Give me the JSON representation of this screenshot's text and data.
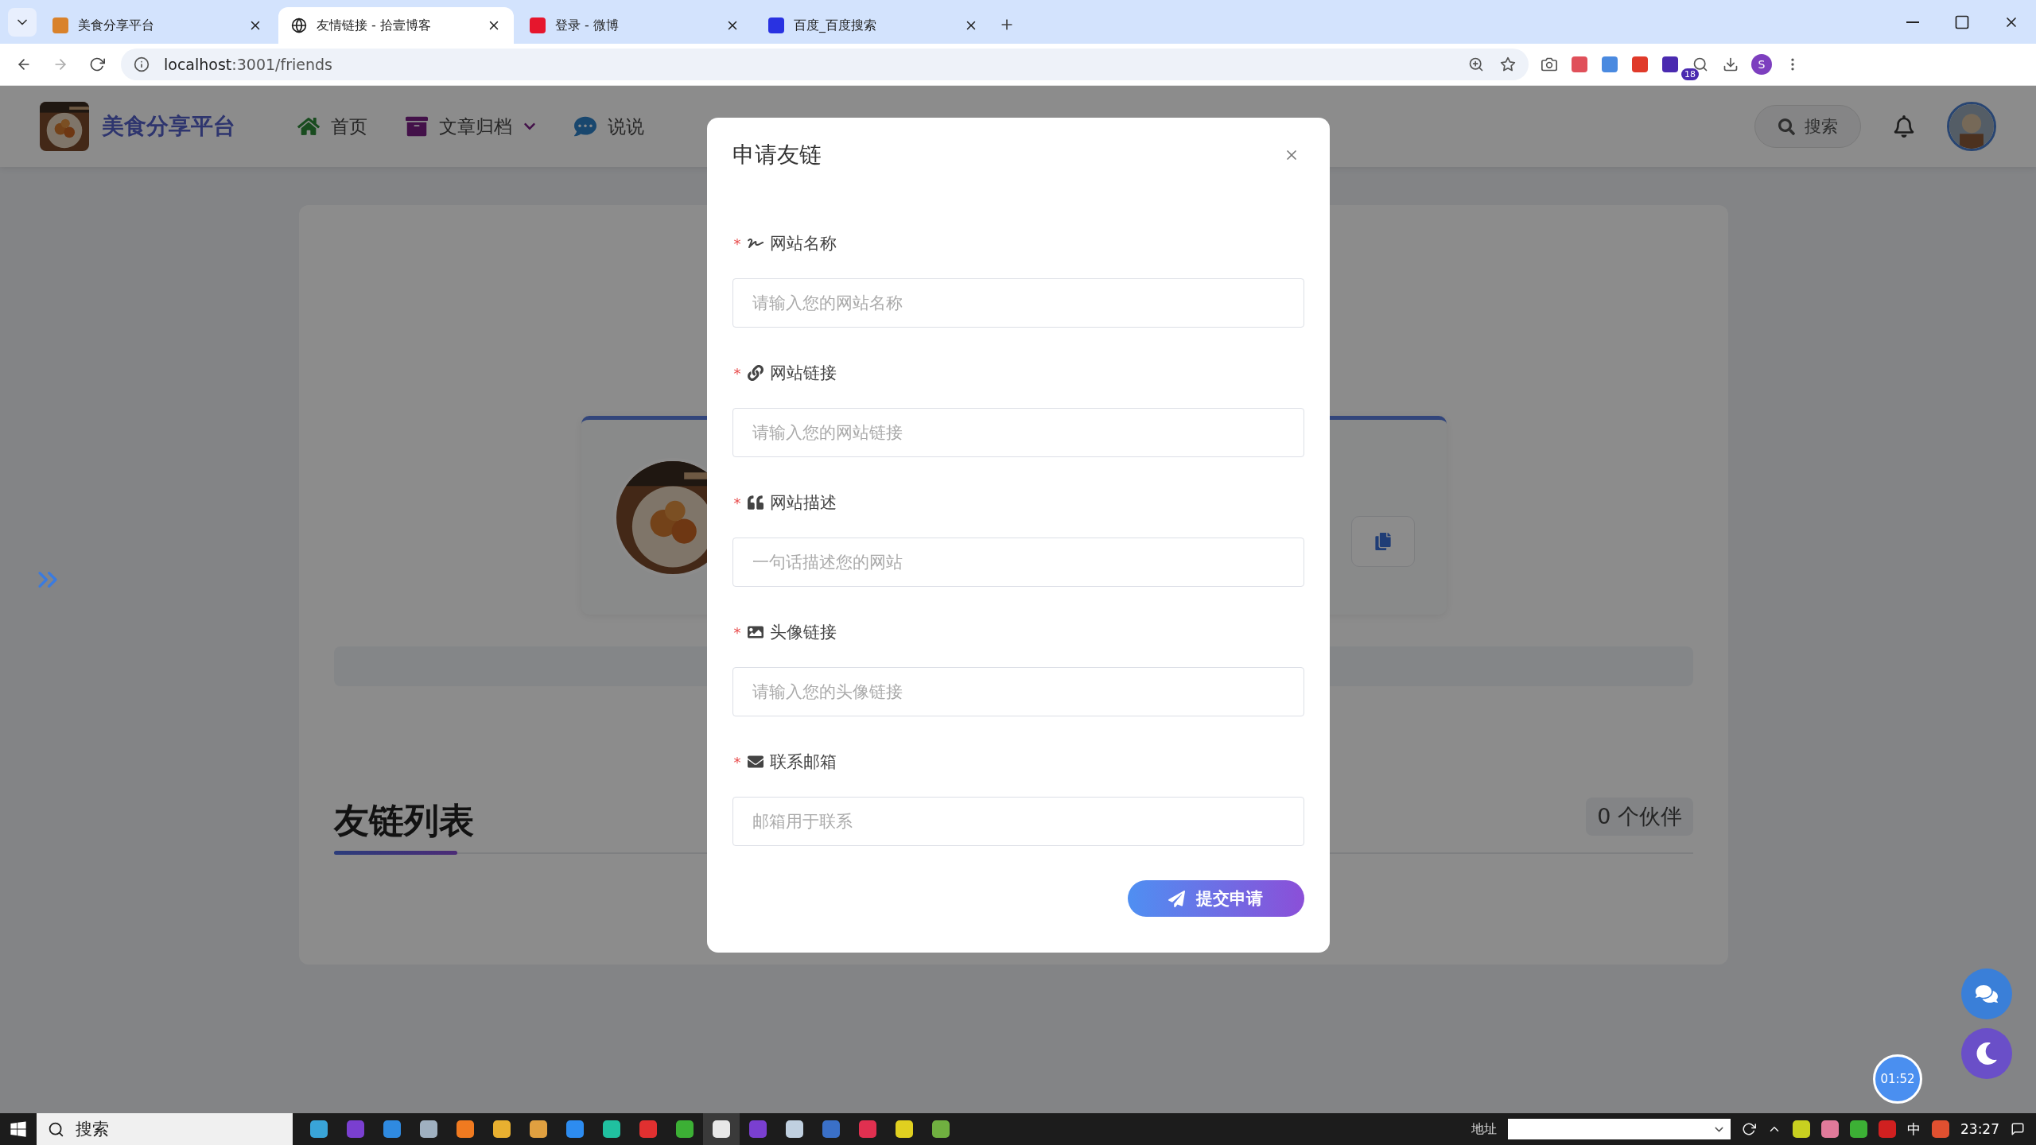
{
  "browser": {
    "tabs": [
      {
        "title": "美食分享平台",
        "selected": false
      },
      {
        "title": "友情链接 - 拾壹博客",
        "selected": true
      },
      {
        "title": "登录 - 微博",
        "selected": false
      },
      {
        "title": "百度_百度搜索",
        "selected": false
      }
    ],
    "url_host": "localhost",
    "url_rest": ":3001/friends",
    "profile_initial": "S",
    "extension_badge": "18"
  },
  "site": {
    "logo_text": "美食分享平台",
    "nav": [
      {
        "label": "首页",
        "has_menu": false
      },
      {
        "label": "文章归档",
        "has_menu": true
      },
      {
        "label": "说说",
        "has_menu": false
      }
    ],
    "search_label": "搜索"
  },
  "page": {
    "section_title": "友链列表",
    "partner_count": "0 个伙伴"
  },
  "dialog": {
    "title": "申请友链",
    "fields": [
      {
        "mark": "*",
        "label": "网站名称",
        "placeholder": "请输入您的网站名称"
      },
      {
        "mark": "*",
        "label": "网站链接",
        "placeholder": "请输入您的网站链接"
      },
      {
        "mark": "*",
        "label": "网站描述",
        "placeholder": "一句话描述您的网站"
      },
      {
        "mark": "*",
        "label": "头像链接",
        "placeholder": "请输入您的头像链接"
      },
      {
        "mark": "*",
        "label": "联系邮箱",
        "placeholder": "邮箱用于联系"
      }
    ],
    "submit": "提交申请"
  },
  "timer": "01:52",
  "taskbar": {
    "search": "搜索",
    "address_label": "地址",
    "ime": "中",
    "time": "23:27"
  }
}
